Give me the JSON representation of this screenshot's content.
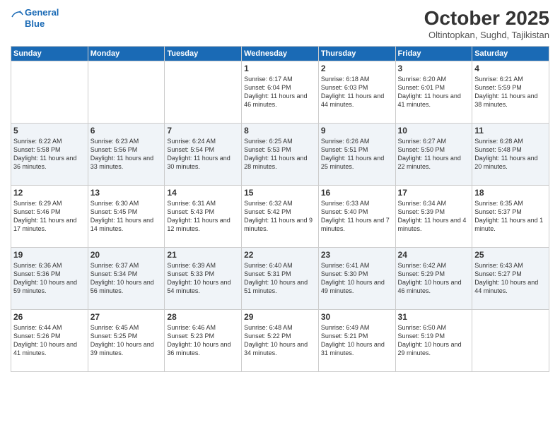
{
  "header": {
    "logo_line1": "General",
    "logo_line2": "Blue",
    "month": "October 2025",
    "location": "Oltintopkan, Sughd, Tajikistan"
  },
  "days_of_week": [
    "Sunday",
    "Monday",
    "Tuesday",
    "Wednesday",
    "Thursday",
    "Friday",
    "Saturday"
  ],
  "weeks": [
    [
      {
        "day": "",
        "info": ""
      },
      {
        "day": "",
        "info": ""
      },
      {
        "day": "",
        "info": ""
      },
      {
        "day": "1",
        "info": "Sunrise: 6:17 AM\nSunset: 6:04 PM\nDaylight: 11 hours and 46 minutes."
      },
      {
        "day": "2",
        "info": "Sunrise: 6:18 AM\nSunset: 6:03 PM\nDaylight: 11 hours and 44 minutes."
      },
      {
        "day": "3",
        "info": "Sunrise: 6:20 AM\nSunset: 6:01 PM\nDaylight: 11 hours and 41 minutes."
      },
      {
        "day": "4",
        "info": "Sunrise: 6:21 AM\nSunset: 5:59 PM\nDaylight: 11 hours and 38 minutes."
      }
    ],
    [
      {
        "day": "5",
        "info": "Sunrise: 6:22 AM\nSunset: 5:58 PM\nDaylight: 11 hours and 36 minutes."
      },
      {
        "day": "6",
        "info": "Sunrise: 6:23 AM\nSunset: 5:56 PM\nDaylight: 11 hours and 33 minutes."
      },
      {
        "day": "7",
        "info": "Sunrise: 6:24 AM\nSunset: 5:54 PM\nDaylight: 11 hours and 30 minutes."
      },
      {
        "day": "8",
        "info": "Sunrise: 6:25 AM\nSunset: 5:53 PM\nDaylight: 11 hours and 28 minutes."
      },
      {
        "day": "9",
        "info": "Sunrise: 6:26 AM\nSunset: 5:51 PM\nDaylight: 11 hours and 25 minutes."
      },
      {
        "day": "10",
        "info": "Sunrise: 6:27 AM\nSunset: 5:50 PM\nDaylight: 11 hours and 22 minutes."
      },
      {
        "day": "11",
        "info": "Sunrise: 6:28 AM\nSunset: 5:48 PM\nDaylight: 11 hours and 20 minutes."
      }
    ],
    [
      {
        "day": "12",
        "info": "Sunrise: 6:29 AM\nSunset: 5:46 PM\nDaylight: 11 hours and 17 minutes."
      },
      {
        "day": "13",
        "info": "Sunrise: 6:30 AM\nSunset: 5:45 PM\nDaylight: 11 hours and 14 minutes."
      },
      {
        "day": "14",
        "info": "Sunrise: 6:31 AM\nSunset: 5:43 PM\nDaylight: 11 hours and 12 minutes."
      },
      {
        "day": "15",
        "info": "Sunrise: 6:32 AM\nSunset: 5:42 PM\nDaylight: 11 hours and 9 minutes."
      },
      {
        "day": "16",
        "info": "Sunrise: 6:33 AM\nSunset: 5:40 PM\nDaylight: 11 hours and 7 minutes."
      },
      {
        "day": "17",
        "info": "Sunrise: 6:34 AM\nSunset: 5:39 PM\nDaylight: 11 hours and 4 minutes."
      },
      {
        "day": "18",
        "info": "Sunrise: 6:35 AM\nSunset: 5:37 PM\nDaylight: 11 hours and 1 minute."
      }
    ],
    [
      {
        "day": "19",
        "info": "Sunrise: 6:36 AM\nSunset: 5:36 PM\nDaylight: 10 hours and 59 minutes."
      },
      {
        "day": "20",
        "info": "Sunrise: 6:37 AM\nSunset: 5:34 PM\nDaylight: 10 hours and 56 minutes."
      },
      {
        "day": "21",
        "info": "Sunrise: 6:39 AM\nSunset: 5:33 PM\nDaylight: 10 hours and 54 minutes."
      },
      {
        "day": "22",
        "info": "Sunrise: 6:40 AM\nSunset: 5:31 PM\nDaylight: 10 hours and 51 minutes."
      },
      {
        "day": "23",
        "info": "Sunrise: 6:41 AM\nSunset: 5:30 PM\nDaylight: 10 hours and 49 minutes."
      },
      {
        "day": "24",
        "info": "Sunrise: 6:42 AM\nSunset: 5:29 PM\nDaylight: 10 hours and 46 minutes."
      },
      {
        "day": "25",
        "info": "Sunrise: 6:43 AM\nSunset: 5:27 PM\nDaylight: 10 hours and 44 minutes."
      }
    ],
    [
      {
        "day": "26",
        "info": "Sunrise: 6:44 AM\nSunset: 5:26 PM\nDaylight: 10 hours and 41 minutes."
      },
      {
        "day": "27",
        "info": "Sunrise: 6:45 AM\nSunset: 5:25 PM\nDaylight: 10 hours and 39 minutes."
      },
      {
        "day": "28",
        "info": "Sunrise: 6:46 AM\nSunset: 5:23 PM\nDaylight: 10 hours and 36 minutes."
      },
      {
        "day": "29",
        "info": "Sunrise: 6:48 AM\nSunset: 5:22 PM\nDaylight: 10 hours and 34 minutes."
      },
      {
        "day": "30",
        "info": "Sunrise: 6:49 AM\nSunset: 5:21 PM\nDaylight: 10 hours and 31 minutes."
      },
      {
        "day": "31",
        "info": "Sunrise: 6:50 AM\nSunset: 5:19 PM\nDaylight: 10 hours and 29 minutes."
      },
      {
        "day": "",
        "info": ""
      }
    ]
  ]
}
